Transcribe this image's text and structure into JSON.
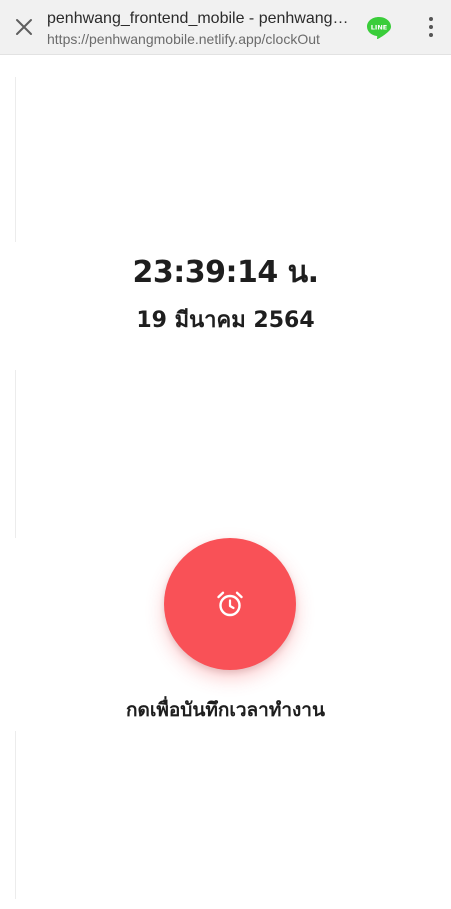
{
  "browser": {
    "page_title": "penhwang_frontend_mobile - penhwang_frontend_mobile",
    "url": "https://penhwangmobile.netlify.app/clockOut",
    "close_icon": "close-icon",
    "share_icon": "line-app-icon",
    "share_icon_text": "LINE",
    "menu_icon": "more-vertical-icon"
  },
  "clock": {
    "time": "23:39:14 น.",
    "date": "19 มีนาคม 2564"
  },
  "action": {
    "button_icon": "alarm-clock-icon",
    "label": "กดเพื่อบันทึกเวลาทำงาน"
  },
  "colors": {
    "button": "#f95157",
    "topbar": "#f1f1f1",
    "text": "#1e1e1e",
    "line_brand": "#3acd3a"
  }
}
